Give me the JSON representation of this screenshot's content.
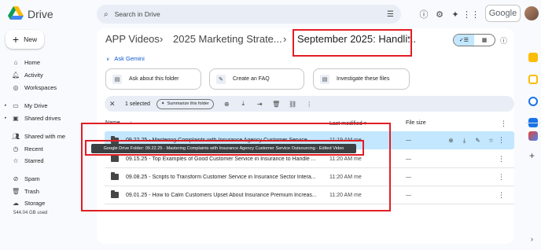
{
  "app": {
    "name": "Drive",
    "search_placeholder": "Search in Drive",
    "google_label": "Google"
  },
  "sidebar": {
    "new_label": "New",
    "items": [
      {
        "label": "Home",
        "icon": "home-icon",
        "glyph": "⌂",
        "caret": ""
      },
      {
        "label": "Activity",
        "icon": "bell-icon",
        "glyph": "🔔︎",
        "caret": ""
      },
      {
        "label": "Workspaces",
        "icon": "workspaces-icon",
        "glyph": "◎",
        "caret": ""
      },
      {
        "label": "My Drive",
        "icon": "my-drive-icon",
        "glyph": "▭",
        "caret": "▸"
      },
      {
        "label": "Shared drives",
        "icon": "shared-drives-icon",
        "glyph": "▣",
        "caret": "▸"
      },
      {
        "label": "Shared with me",
        "icon": "people-icon",
        "glyph": "👥︎",
        "caret": ""
      },
      {
        "label": "Recent",
        "icon": "clock-icon",
        "glyph": "◷",
        "caret": ""
      },
      {
        "label": "Starred",
        "icon": "star-icon",
        "glyph": "☆",
        "caret": ""
      },
      {
        "label": "Spam",
        "icon": "spam-icon",
        "glyph": "⊘",
        "caret": ""
      },
      {
        "label": "Trash",
        "icon": "trash-icon",
        "glyph": "🗑︎",
        "caret": ""
      },
      {
        "label": "Storage",
        "icon": "cloud-icon",
        "glyph": "☁",
        "caret": ""
      }
    ],
    "storage_text": "544.04 GB used"
  },
  "breadcrumb": {
    "items": [
      "APP Videos",
      "2025 Marketing Strate...",
      "September 2025: Handli..."
    ],
    "separator": "›"
  },
  "gemini": {
    "label": "Ask Gemini"
  },
  "suggestions": [
    "Ask about this folder",
    "Create an FAQ",
    "Investigate these files"
  ],
  "selection": {
    "count_label": "1 selected",
    "summarize_label": "Summarize this folder"
  },
  "table": {
    "headers": {
      "name": "Name",
      "modified": "Last modified",
      "size": "File size"
    },
    "rows": [
      {
        "name": "09.22.25 - Mastering Complaints with Insurance Agency Customer Service...",
        "modified": "11:19 AM me",
        "size": "—",
        "selected": true
      },
      {
        "name": "09.15.25 - Top Examples of Good Customer Service in Insurance to Handle ...",
        "modified": "11:20 AM me",
        "size": "—",
        "selected": false
      },
      {
        "name": "09.08.25 - Scripts to Transform Customer Service in Insurance Sector Intera...",
        "modified": "11:20 AM me",
        "size": "—",
        "selected": false
      },
      {
        "name": "09.01.25 - How to Calm Customers Upset About Insurance Premium Increas...",
        "modified": "11:20 AM me",
        "size": "—",
        "selected": false
      }
    ]
  },
  "tooltip": "Google Drive Folder: 09.22.25 - Mastering Complaints with Insurance Agency Customer Service Outsourcing - Edited Video",
  "colors": {
    "accent": "#0b57d0",
    "selected_row": "#c2e7ff",
    "annotation": "#e21d24"
  }
}
